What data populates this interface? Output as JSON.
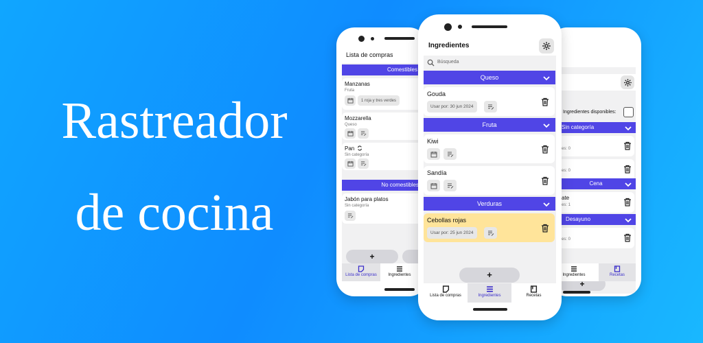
{
  "headline": {
    "line1": "Rastreador",
    "line2": "de cocina"
  },
  "left_phone": {
    "title": "Lista de compras",
    "sections": [
      "Comestibles",
      "No comestibles"
    ],
    "items": [
      {
        "name": "Manzanas",
        "category": "Fruta",
        "note": "1 roja y tres verdes"
      },
      {
        "name": "Mozzarella",
        "category": "Queso"
      },
      {
        "name": "Pan",
        "category": "Sin categoría"
      },
      {
        "name": "Jabón para platos",
        "category": "Sin categoría"
      }
    ],
    "add_label": "+",
    "nav": [
      "Lista de compras",
      "Ingredientes"
    ]
  },
  "center_phone": {
    "title": "Ingredientes",
    "search_placeholder": "Búsqueda",
    "sections": [
      "Queso",
      "Fruta",
      "Verduras"
    ],
    "items": [
      {
        "name": "Gouda",
        "use_by": "Usar por: 30 jun 2024"
      },
      {
        "name": "Kiwi"
      },
      {
        "name": "Sandía"
      },
      {
        "name": "Cebollas rojas",
        "use_by": "Usar por: 25 jun 2024"
      }
    ],
    "add_label": "+",
    "nav": [
      "Lista de compras",
      "Ingredientes",
      "Recetas"
    ]
  },
  "right_phone": {
    "available_label": "Ingredientes disponibles:",
    "sections": [
      "Sin categoría",
      "Cena",
      "Desayuno"
    ],
    "cards": [
      {
        "sub": "es: 0"
      },
      {
        "sub": "es: 0"
      },
      {
        "name": "ate",
        "sub": "es: 1"
      },
      {
        "sub": "es: 0"
      }
    ],
    "add_label": "+",
    "nav": [
      "Ingredientes",
      "Recetas"
    ]
  },
  "colors": {
    "accent": "#5045e6",
    "highlight": "#ffe49a",
    "background": "#0f8cff"
  }
}
